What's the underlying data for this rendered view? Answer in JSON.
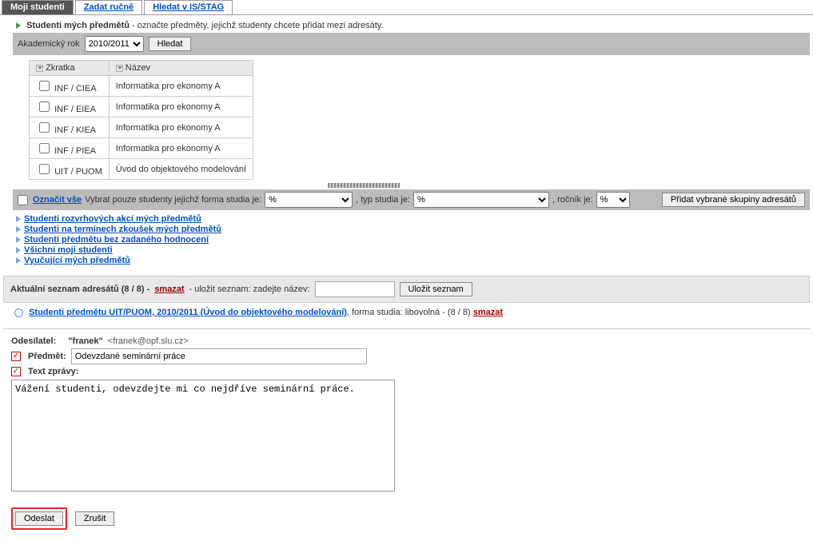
{
  "tabs": {
    "active": "Moji studenti",
    "t2": "Zadat ručně",
    "t3": "Hledat v IS/STAG"
  },
  "section": {
    "heading_bold": "Studenti mých předmětů",
    "heading_rest": " - označte předměty, jejichž studenty chcete přidat mezi adresáty."
  },
  "year_bar": {
    "label": "Akademický rok",
    "value": "2010/2011",
    "search_btn": "Hledat"
  },
  "table": {
    "col_code": "Zkratka",
    "col_name": "Název",
    "rows": [
      {
        "code": "INF / CIEA",
        "name": "Informatika pro ekonomy A"
      },
      {
        "code": "INF / EIEA",
        "name": "Informatika pro ekonomy A"
      },
      {
        "code": "INF / KIEA",
        "name": "Informatika pro ekonomy A"
      },
      {
        "code": "INF / PIEA",
        "name": "Informatika pro ekonomy A"
      },
      {
        "code": "UIT / PUOM",
        "name": "Úvod do objektového modelování"
      }
    ]
  },
  "filter": {
    "mark_all": "Označit vše",
    "text1": "Vybrat pouze studenty jejichž forma studia je:",
    "opt_any": "%",
    "text2": ", typ studia je:",
    "text3": ", ročník je:",
    "add_btn": "Přidat vybrané skupiny adresátů"
  },
  "links": {
    "l1": "Studenti rozvrhových akcí mých předmětů",
    "l2": "Studenti na termínech zkoušek mých předmětů",
    "l3": "Studenti předmětu bez zadaného hodnocení",
    "l4": "Všichni moji studenti",
    "l5": "Vyučující mých předmětů"
  },
  "recipients": {
    "label": "Aktuální seznam adresátů (8 / 8) - ",
    "smazat": "smazat",
    "save_text": " - uložit seznam: zadejte název:",
    "save_btn": "Uložit seznam"
  },
  "group": {
    "link": "Studenti předmětu UIT/PUOM, 2010/2011 (Úvod do objektového modelování)",
    "rest": ",  forma studia: libovolná - (8 / 8) ",
    "smazat": "smazat"
  },
  "compose": {
    "sender_label": "Odesílatel:",
    "sender_name": "\"franek\"",
    "sender_email": "<franek@opf.slu.cz>",
    "subject_label": "Předmět:",
    "subject_value": "Odevzdané seminární práce",
    "body_label": "Text zprávy:",
    "body_value": "Vážení studenti, odevzdejte mi co nejdříve seminární práce.",
    "send_btn": "Odeslat",
    "cancel_btn": "Zrušit"
  }
}
